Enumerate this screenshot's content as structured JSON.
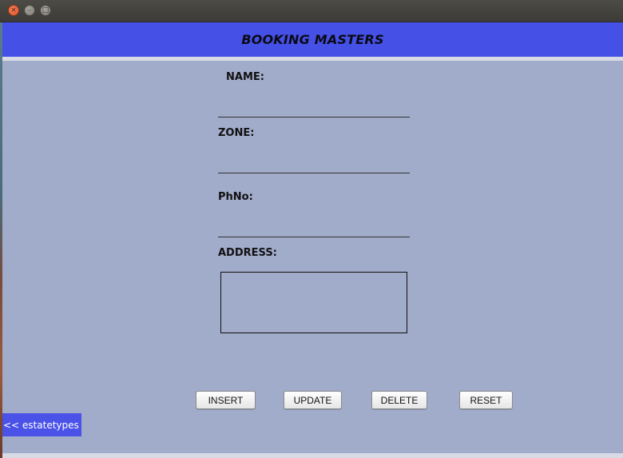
{
  "window": {
    "controls": {
      "close_icon": "×",
      "minimize_icon": "–",
      "maximize_icon": "□"
    }
  },
  "header": {
    "title": "BOOKING MASTERS"
  },
  "form": {
    "name_label": "NAME:",
    "name_value": "",
    "zone_label": "ZONE:",
    "zone_value": "",
    "phno_label": "PhNo:",
    "phno_value": "",
    "address_label": "ADDRESS:",
    "address_value": ""
  },
  "actions": {
    "insert_label": "INSERT",
    "update_label": "UPDATE",
    "delete_label": "DELETE",
    "reset_label": "RESET"
  },
  "nav": {
    "back_label": "<< estatetypes"
  },
  "colors": {
    "header_bg": "#4450e6",
    "panel_bg": "#a1abca",
    "nav_bg": "#4a52e8"
  }
}
